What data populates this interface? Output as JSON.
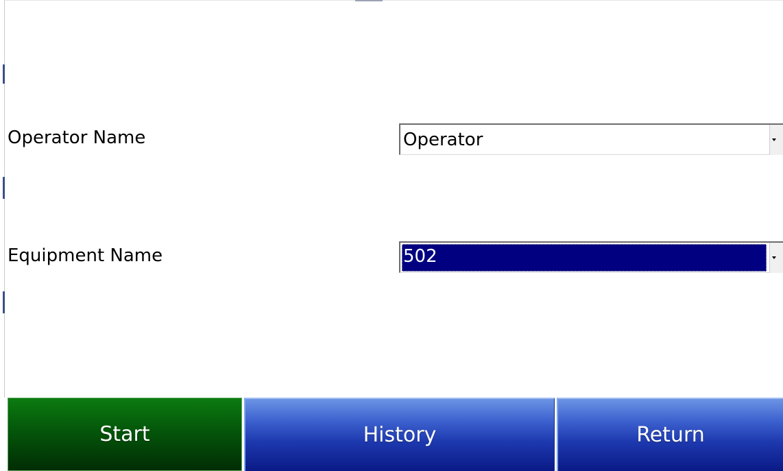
{
  "form": {
    "operator_label": "Operator Name",
    "operator_value": "Operator",
    "equipment_label": "Equipment Name",
    "equipment_value": "502"
  },
  "buttons": {
    "start": "Start",
    "history": "History",
    "return": "Return"
  },
  "colors": {
    "start_button": "#04560a",
    "nav_button": "#1d38ae",
    "selected_highlight": "#000080"
  },
  "icons": {
    "dropdown": "chevron-down-icon"
  }
}
